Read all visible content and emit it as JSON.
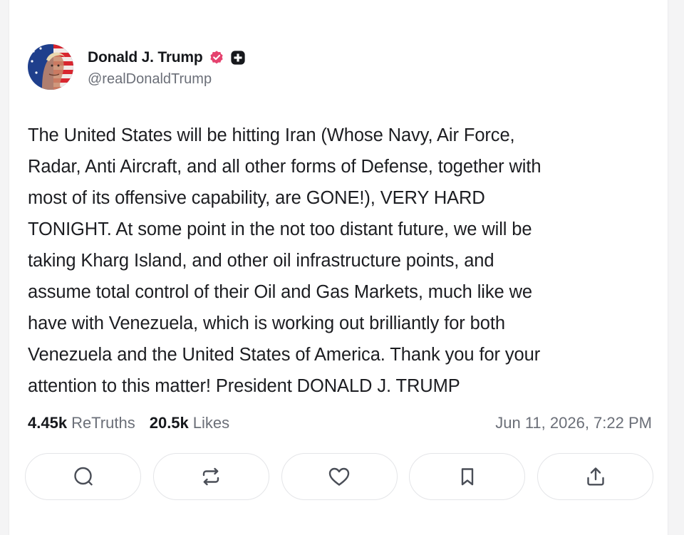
{
  "post": {
    "author": {
      "display_name": "Donald J. Trump",
      "handle": "@realDonaldTrump",
      "avatar_icon": "avatar-flag-portrait",
      "verified_icon": "verified-badge-icon",
      "verified_color": "#e5426e",
      "plus_icon": "plus-badge-icon"
    },
    "text": "The United States will be hitting Iran (Whose Navy, Air Force,\nRadar, Anti Aircraft, and all other forms of Defense, together with\nmost of its offensive capability, are GONE!), VERY HARD\nTONIGHT. At some point in the not too distant  future, we will be\ntaking Kharg Island, and other oil infrastructure points, and\nassume total control of their Oil and Gas Markets, much like we\nhave with Venezuela, which is working out brilliantly for both\nVenezuela and the United States of America. Thank you for your\nattention to this matter! President DONALD J. TRUMP",
    "stats": {
      "retruths_count": "4.45k",
      "retruths_label": "ReTruths",
      "likes_count": "20.5k",
      "likes_label": "Likes"
    },
    "timestamp": "Jun 11, 2026, 7:22 PM"
  },
  "actions": [
    {
      "name": "reply",
      "icon": "comment-icon"
    },
    {
      "name": "retruth",
      "icon": "repost-icon"
    },
    {
      "name": "like",
      "icon": "heart-icon"
    },
    {
      "name": "bookmark",
      "icon": "bookmark-icon"
    },
    {
      "name": "share",
      "icon": "share-icon"
    }
  ]
}
